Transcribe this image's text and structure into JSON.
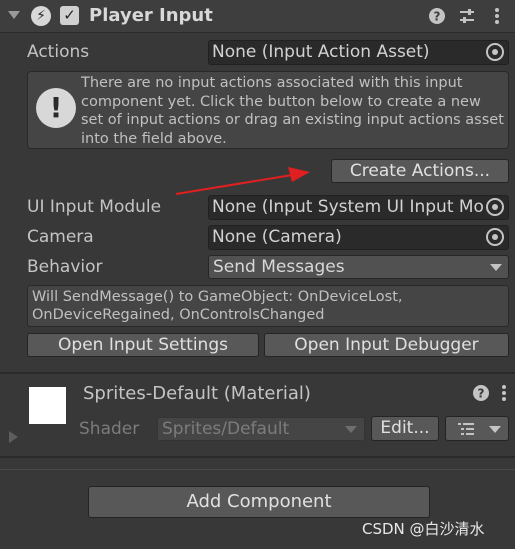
{
  "component": {
    "title": "Player Input",
    "enabled": true,
    "help_icon": "help-icon",
    "settings_icon": "preset-sliders-icon",
    "menu_icon": "kebab-menu-icon"
  },
  "actions": {
    "label": "Actions",
    "value": "None (Input Action Asset)"
  },
  "help_box": {
    "text": "There are no input actions associated with this input component yet. Click the button below to create a new set of input actions or drag an existing input actions asset into the field above."
  },
  "create_actions_button": "Create Actions...",
  "ui_input_module": {
    "label": "UI Input Module",
    "value": "None (Input System UI Input Mo"
  },
  "camera": {
    "label": "Camera",
    "value": "None (Camera)"
  },
  "behavior": {
    "label": "Behavior",
    "value": "Send Messages"
  },
  "info_box": {
    "text": "Will SendMessage() to GameObject: OnDeviceLost, OnDeviceRegained, OnControlsChanged"
  },
  "open_input_settings_button": "Open Input Settings",
  "open_input_debugger_button": "Open Input Debugger",
  "material": {
    "title": "Sprites-Default (Material)",
    "shader_label": "Shader",
    "shader_value": "Sprites/Default",
    "edit_button": "Edit..."
  },
  "add_component_button": "Add Component",
  "watermark": "CSDN @白沙清水",
  "colors": {
    "background": "#383838",
    "annotation_arrow": "#e02020"
  }
}
